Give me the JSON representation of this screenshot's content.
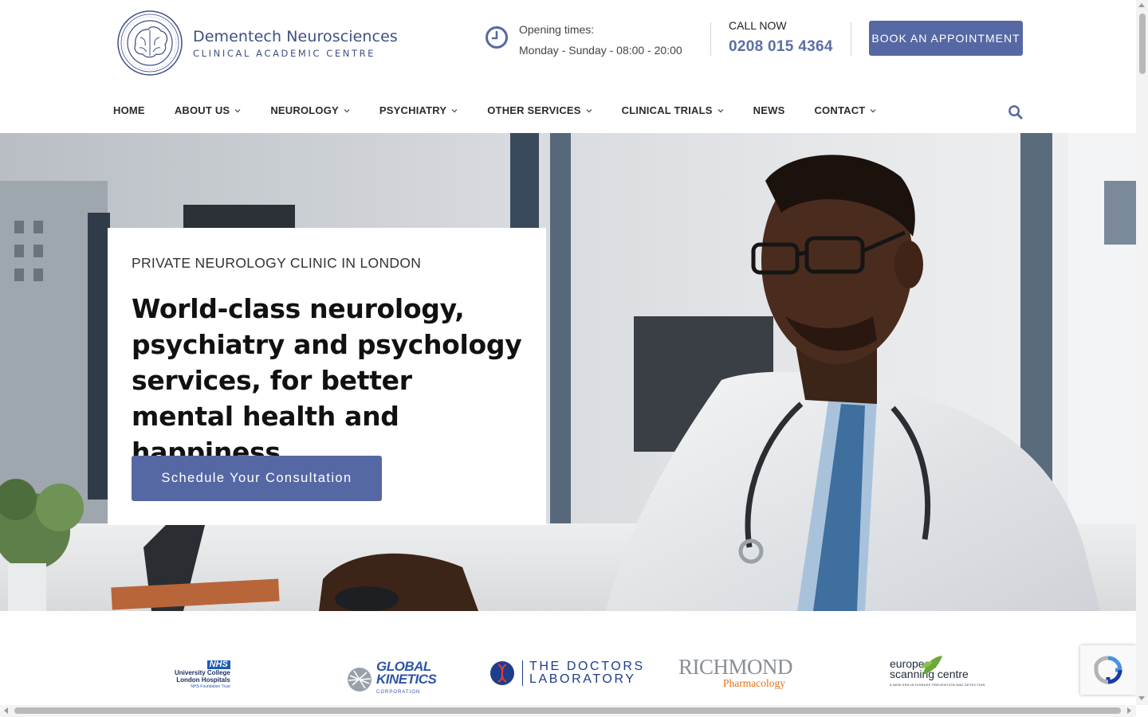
{
  "brand": {
    "name": "Dementech Neurosciences",
    "subtitle": "CLINICAL ACADEMIC CENTRE",
    "color": "#3e4f86",
    "accent": "#5668a4"
  },
  "header": {
    "opening_label": "Opening times:",
    "opening_hours": "Monday - Sunday - 08:00 - 20:00",
    "call_label": "CALL NOW",
    "call_number": "0208 015 4364",
    "book_button": "BOOK AN APPOINTMENT"
  },
  "nav": {
    "items": [
      {
        "label": "HOME",
        "dropdown": false
      },
      {
        "label": "ABOUT US",
        "dropdown": true
      },
      {
        "label": "NEUROLOGY",
        "dropdown": true
      },
      {
        "label": "PSYCHIATRY",
        "dropdown": true
      },
      {
        "label": "OTHER SERVICES",
        "dropdown": true
      },
      {
        "label": "CLINICAL TRIALS",
        "dropdown": true
      },
      {
        "label": "NEWS",
        "dropdown": false
      },
      {
        "label": "CONTACT",
        "dropdown": true
      }
    ],
    "search_icon": "search-icon"
  },
  "hero": {
    "kicker": "PRIVATE NEUROLOGY CLINIC IN LONDON",
    "title": "World-class neurology, psychiatry and psychology services, for better mental health and happiness",
    "cta": "Schedule Your Consultation"
  },
  "partners": {
    "nhs": {
      "badge": "NHS",
      "line1": "University College",
      "line2": "London Hospitals",
      "line3": "NHS Foundation Trust"
    },
    "global_kinetics": {
      "line1": "GLOBAL",
      "line2": "KINETICS",
      "line3": "CORPORATION"
    },
    "doctors_lab": {
      "line1": "THE DOCTORS",
      "line2": "LABORATORY"
    },
    "richmond": {
      "line1": "RICHMOND",
      "line2": "Pharmacology"
    },
    "european_scanning": {
      "line1": "european",
      "line2": "scanning centre",
      "line3": "A NEW ERA IN DISEASE PREVENTION AND DETECTION"
    }
  }
}
